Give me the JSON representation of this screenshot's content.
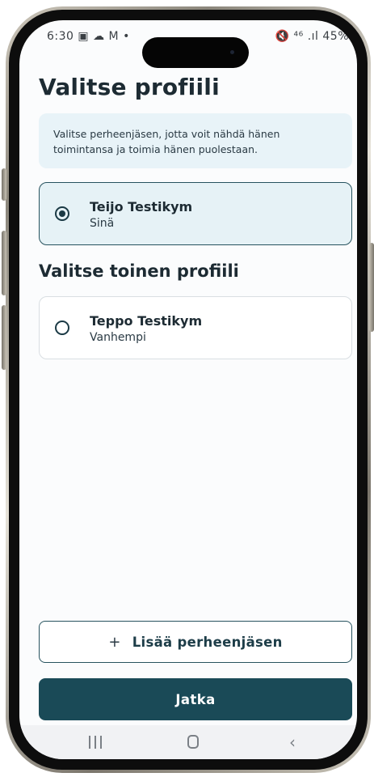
{
  "status_bar": {
    "time": "6:30",
    "left_icons": "▣ ☁ M •",
    "right_text": "🔇 ⁴⁶ .ıl 45%"
  },
  "page": {
    "title": "Valitse profiili",
    "info_text": "Valitse perheenjäsen, jotta voit nähdä hänen toimintansa ja toimia hänen puolestaan.",
    "other_profiles_title": "Valitse toinen profiili"
  },
  "profiles": [
    {
      "name": "Teijo Testikym",
      "role": "Sinä",
      "selected": true
    },
    {
      "name": "Teppo Testikym",
      "role": "Vanhempi",
      "selected": false
    }
  ],
  "actions": {
    "add_member_icon": "+",
    "add_member_label": "Lisää perheenjäsen",
    "continue_label": "Jatka"
  },
  "colors": {
    "primary": "#1a4a57",
    "info_background": "#e8f3f8",
    "selected_card": "#e6f2f6"
  },
  "navbar": {
    "icons": [
      "recent-apps-icon",
      "home-icon",
      "back-icon"
    ]
  }
}
